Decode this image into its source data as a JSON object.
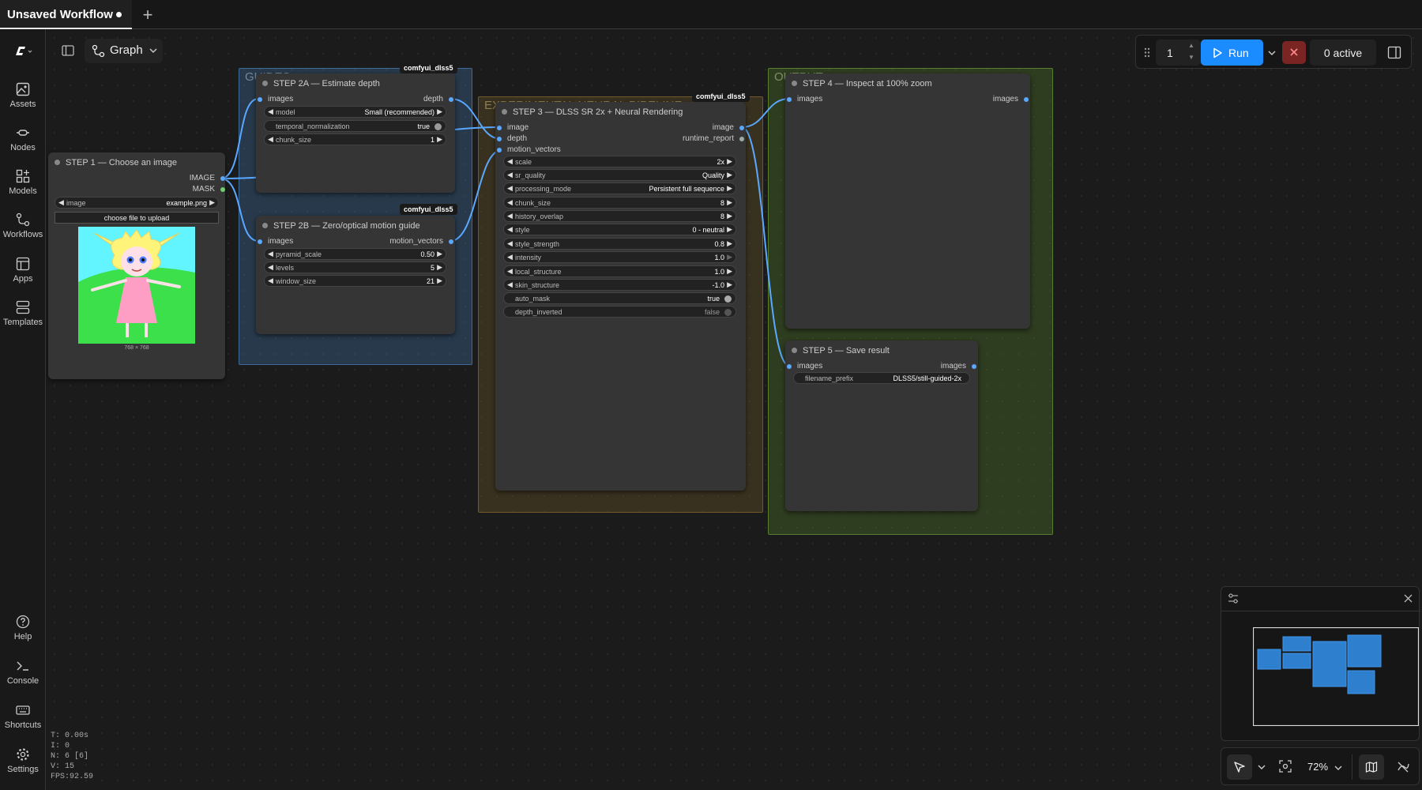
{
  "tab": {
    "title": "Unsaved Workflow",
    "new_tab": "+"
  },
  "sidebar": {
    "items": [
      {
        "label": "Assets"
      },
      {
        "label": "Nodes"
      },
      {
        "label": "Models"
      },
      {
        "label": "Workflows"
      },
      {
        "label": "Apps"
      },
      {
        "label": "Templates"
      },
      {
        "label": "Help"
      },
      {
        "label": "Console"
      },
      {
        "label": "Shortcuts"
      },
      {
        "label": "Settings"
      }
    ]
  },
  "view": {
    "mode": "Graph"
  },
  "toolbar": {
    "queue_count": "1",
    "run_label": "Run",
    "active_label": "0 active"
  },
  "groups": {
    "guide": "GUIDES",
    "experimental": "EXPERIMENTAL NEURAL PIPELINE",
    "output": "OUTPUT"
  },
  "nodes": {
    "step1": {
      "title": "STEP 1 — Choose an image",
      "outputs": [
        "IMAGE",
        "MASK"
      ],
      "image_widget": {
        "label": "image",
        "value": "example.png"
      },
      "upload_label": "choose file to upload",
      "dims": "768 × 768"
    },
    "step2a": {
      "title": "STEP 2A — Estimate depth",
      "badge": "comfyui_dlss5",
      "input": "images",
      "output": "depth",
      "widgets": [
        {
          "label": "model",
          "value": "Small (recommended)"
        },
        {
          "label": "temporal_normalization",
          "value": "true"
        },
        {
          "label": "chunk_size",
          "value": "1"
        }
      ]
    },
    "step2b": {
      "title": "STEP 2B — Zero/optical motion guide",
      "badge": "comfyui_dlss5",
      "input": "images",
      "output": "motion_vectors",
      "widgets": [
        {
          "label": "pyramid_scale",
          "value": "0.50"
        },
        {
          "label": "levels",
          "value": "5"
        },
        {
          "label": "window_size",
          "value": "21"
        }
      ]
    },
    "step3": {
      "title": "STEP 3 — DLSS SR 2x + Neural Rendering",
      "badge": "comfyui_dlss5",
      "inputs": [
        "image",
        "depth",
        "motion_vectors"
      ],
      "outputs": [
        "image",
        "runtime_report"
      ],
      "widgets": [
        {
          "label": "scale",
          "value": "2x"
        },
        {
          "label": "sr_quality",
          "value": "Quality"
        },
        {
          "label": "processing_mode",
          "value": "Persistent full sequence"
        },
        {
          "label": "chunk_size",
          "value": "8"
        },
        {
          "label": "history_overlap",
          "value": "8"
        },
        {
          "label": "style",
          "value": "0 - neutral"
        },
        {
          "label": "style_strength",
          "value": "0.8"
        },
        {
          "label": "intensity",
          "value": "1.0"
        },
        {
          "label": "local_structure",
          "value": "1.0"
        },
        {
          "label": "skin_structure",
          "value": "-1.0"
        },
        {
          "label": "auto_mask",
          "value": "true"
        },
        {
          "label": "depth_inverted",
          "value": "false"
        }
      ]
    },
    "step4": {
      "title": "STEP 4 — Inspect at 100% zoom",
      "input": "images",
      "output": "images"
    },
    "step5": {
      "title": "STEP 5 — Save result",
      "input": "images",
      "output": "images",
      "widget": {
        "label": "filename_prefix",
        "value": "DLSS5/still-guided-2x"
      }
    }
  },
  "zoom": {
    "level": "72%"
  },
  "stats": {
    "t": "T: 0.00s",
    "i": "I: 0",
    "n": "N: 6 [6]",
    "v": "V: 15",
    "fps": "FPS:92.59"
  },
  "colors": {
    "accent": "#1a8cff",
    "link": "#5aa8ff",
    "guide_group": "#4a88c8",
    "experimental_group": "#a0803c",
    "output_group": "#6e9f3e",
    "stop": "#7a2424"
  }
}
